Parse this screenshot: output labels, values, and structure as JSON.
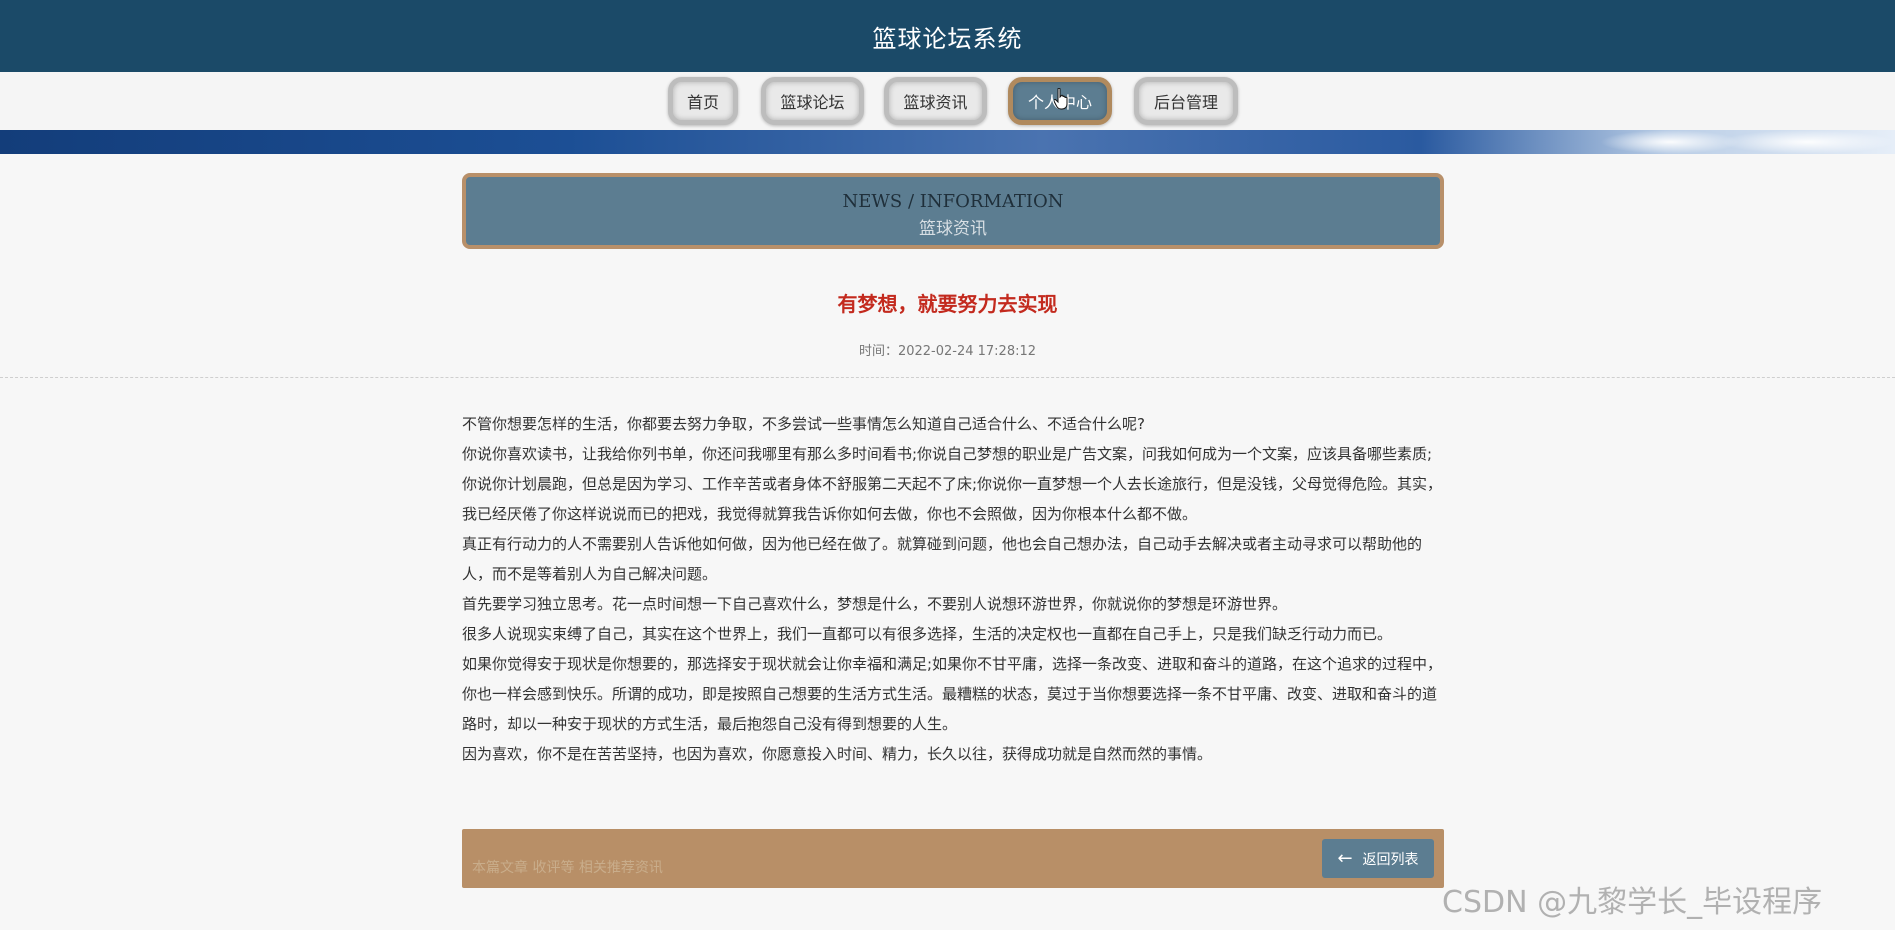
{
  "header": {
    "site_title": "篮球论坛系统"
  },
  "nav": {
    "items": [
      {
        "label": "首页",
        "active": false
      },
      {
        "label": "篮球论坛",
        "active": false
      },
      {
        "label": "篮球资讯",
        "active": false
      },
      {
        "label": "个人中心",
        "active": true
      },
      {
        "label": "后台管理",
        "active": false
      }
    ]
  },
  "section": {
    "title_en": "NEWS / INFORMATION",
    "title_cn": "篮球资讯"
  },
  "article": {
    "title": "有梦想，就要努力去实现",
    "time": "时间：2022-02-24 17:28:12",
    "paragraphs": [
      "不管你想要怎样的生活，你都要去努力争取，不多尝试一些事情怎么知道自己适合什么、不适合什么呢?",
      "你说你喜欢读书，让我给你列书单，你还问我哪里有那么多时间看书;你说自己梦想的职业是广告文案，问我如何成为一个文案，应该具备哪些素质;你说你计划晨跑，但总是因为学习、工作辛苦或者身体不舒服第二天起不了床;你说你一直梦想一个人去长途旅行，但是没钱，父母觉得危险。其实，我已经厌倦了你这样说说而已的把戏，我觉得就算我告诉你如何去做，你也不会照做，因为你根本什么都不做。",
      "真正有行动力的人不需要别人告诉他如何做，因为他已经在做了。就算碰到问题，他也会自己想办法，自己动手去解决或者主动寻求可以帮助他的人，而不是等着别人为自己解决问题。",
      "首先要学习独立思考。花一点时间想一下自己喜欢什么，梦想是什么，不要别人说想环游世界，你就说你的梦想是环游世界。",
      "很多人说现实束缚了自己，其实在这个世界上，我们一直都可以有很多选择，生活的决定权也一直都在自己手上，只是我们缺乏行动力而已。",
      "如果你觉得安于现状是你想要的，那选择安于现状就会让你幸福和满足;如果你不甘平庸，选择一条改变、进取和奋斗的道路，在这个追求的过程中，你也一样会感到快乐。所谓的成功，即是按照自己想要的生活方式生活。最糟糕的状态，莫过于当你想要选择一条不甘平庸、改变、进取和奋斗的道路时，却以一种安于现状的方式生活，最后抱怨自己没有得到想要的人生。",
      "因为喜欢，你不是在苦苦坚持，也因为喜欢，你愿意投入时间、精力，长久以往，获得成功就是自然而然的事情。"
    ]
  },
  "footer": {
    "links_text": "本篇文章  收评等  相关推荐资讯",
    "back_label": "返回列表",
    "back_icon": "arrow-left-icon"
  },
  "watermark": "CSDN @九黎学长_毕设程序",
  "colors": {
    "topbar": "#1b4a68",
    "accent": "#5c7d91",
    "border_tan": "#b8906a",
    "title_red": "#c32a1e"
  }
}
